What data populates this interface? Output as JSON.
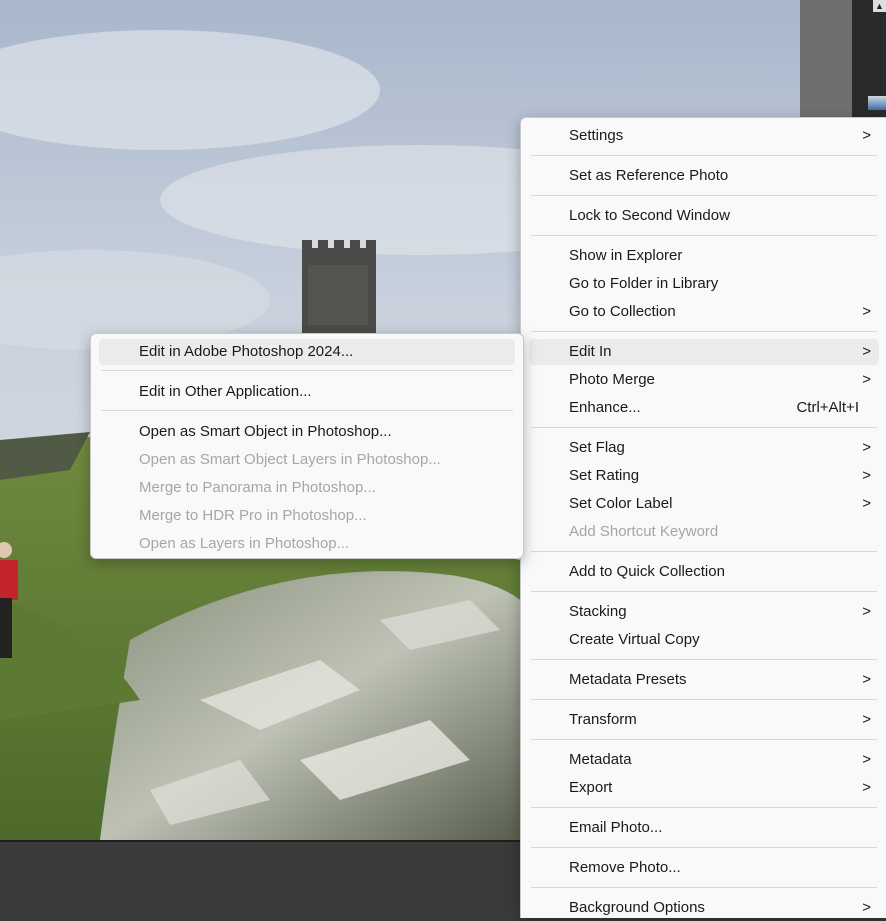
{
  "main_menu": {
    "items": [
      {
        "label": "Settings",
        "submenu": true
      },
      {
        "label": "Set as Reference Photo"
      },
      {
        "label": "Lock to Second Window"
      },
      {
        "label": "Show in Explorer"
      },
      {
        "label": "Go to Folder in Library"
      },
      {
        "label": "Go to Collection",
        "submenu": true
      },
      {
        "label": "Edit In",
        "submenu": true,
        "highlighted": true
      },
      {
        "label": "Photo Merge",
        "submenu": true
      },
      {
        "label": "Enhance...",
        "shortcut": "Ctrl+Alt+I"
      },
      {
        "label": "Set Flag",
        "submenu": true
      },
      {
        "label": "Set Rating",
        "submenu": true
      },
      {
        "label": "Set Color Label",
        "submenu": true
      },
      {
        "label": "Add Shortcut Keyword",
        "disabled": true
      },
      {
        "label": "Add to Quick Collection"
      },
      {
        "label": "Stacking",
        "submenu": true
      },
      {
        "label": "Create Virtual Copy"
      },
      {
        "label": "Metadata Presets",
        "submenu": true
      },
      {
        "label": "Transform",
        "submenu": true
      },
      {
        "label": "Metadata",
        "submenu": true
      },
      {
        "label": "Export",
        "submenu": true
      },
      {
        "label": "Email Photo..."
      },
      {
        "label": "Remove Photo..."
      },
      {
        "label": "Background Options",
        "submenu": true
      }
    ],
    "arrow": ">"
  },
  "edit_in_submenu": {
    "items": [
      {
        "label": "Edit in Adobe Photoshop 2024...",
        "highlighted": true
      },
      {
        "label": "Edit in Other Application..."
      },
      {
        "label": "Open as Smart Object in Photoshop..."
      },
      {
        "label": "Open as Smart Object Layers in Photoshop...",
        "disabled": true
      },
      {
        "label": "Merge to Panorama in Photoshop...",
        "disabled": true
      },
      {
        "label": "Merge to HDR Pro in Photoshop...",
        "disabled": true
      },
      {
        "label": "Open as Layers in Photoshop...",
        "disabled": true
      }
    ]
  },
  "filmstrip": {
    "scroll_up_glyph": "▲"
  }
}
